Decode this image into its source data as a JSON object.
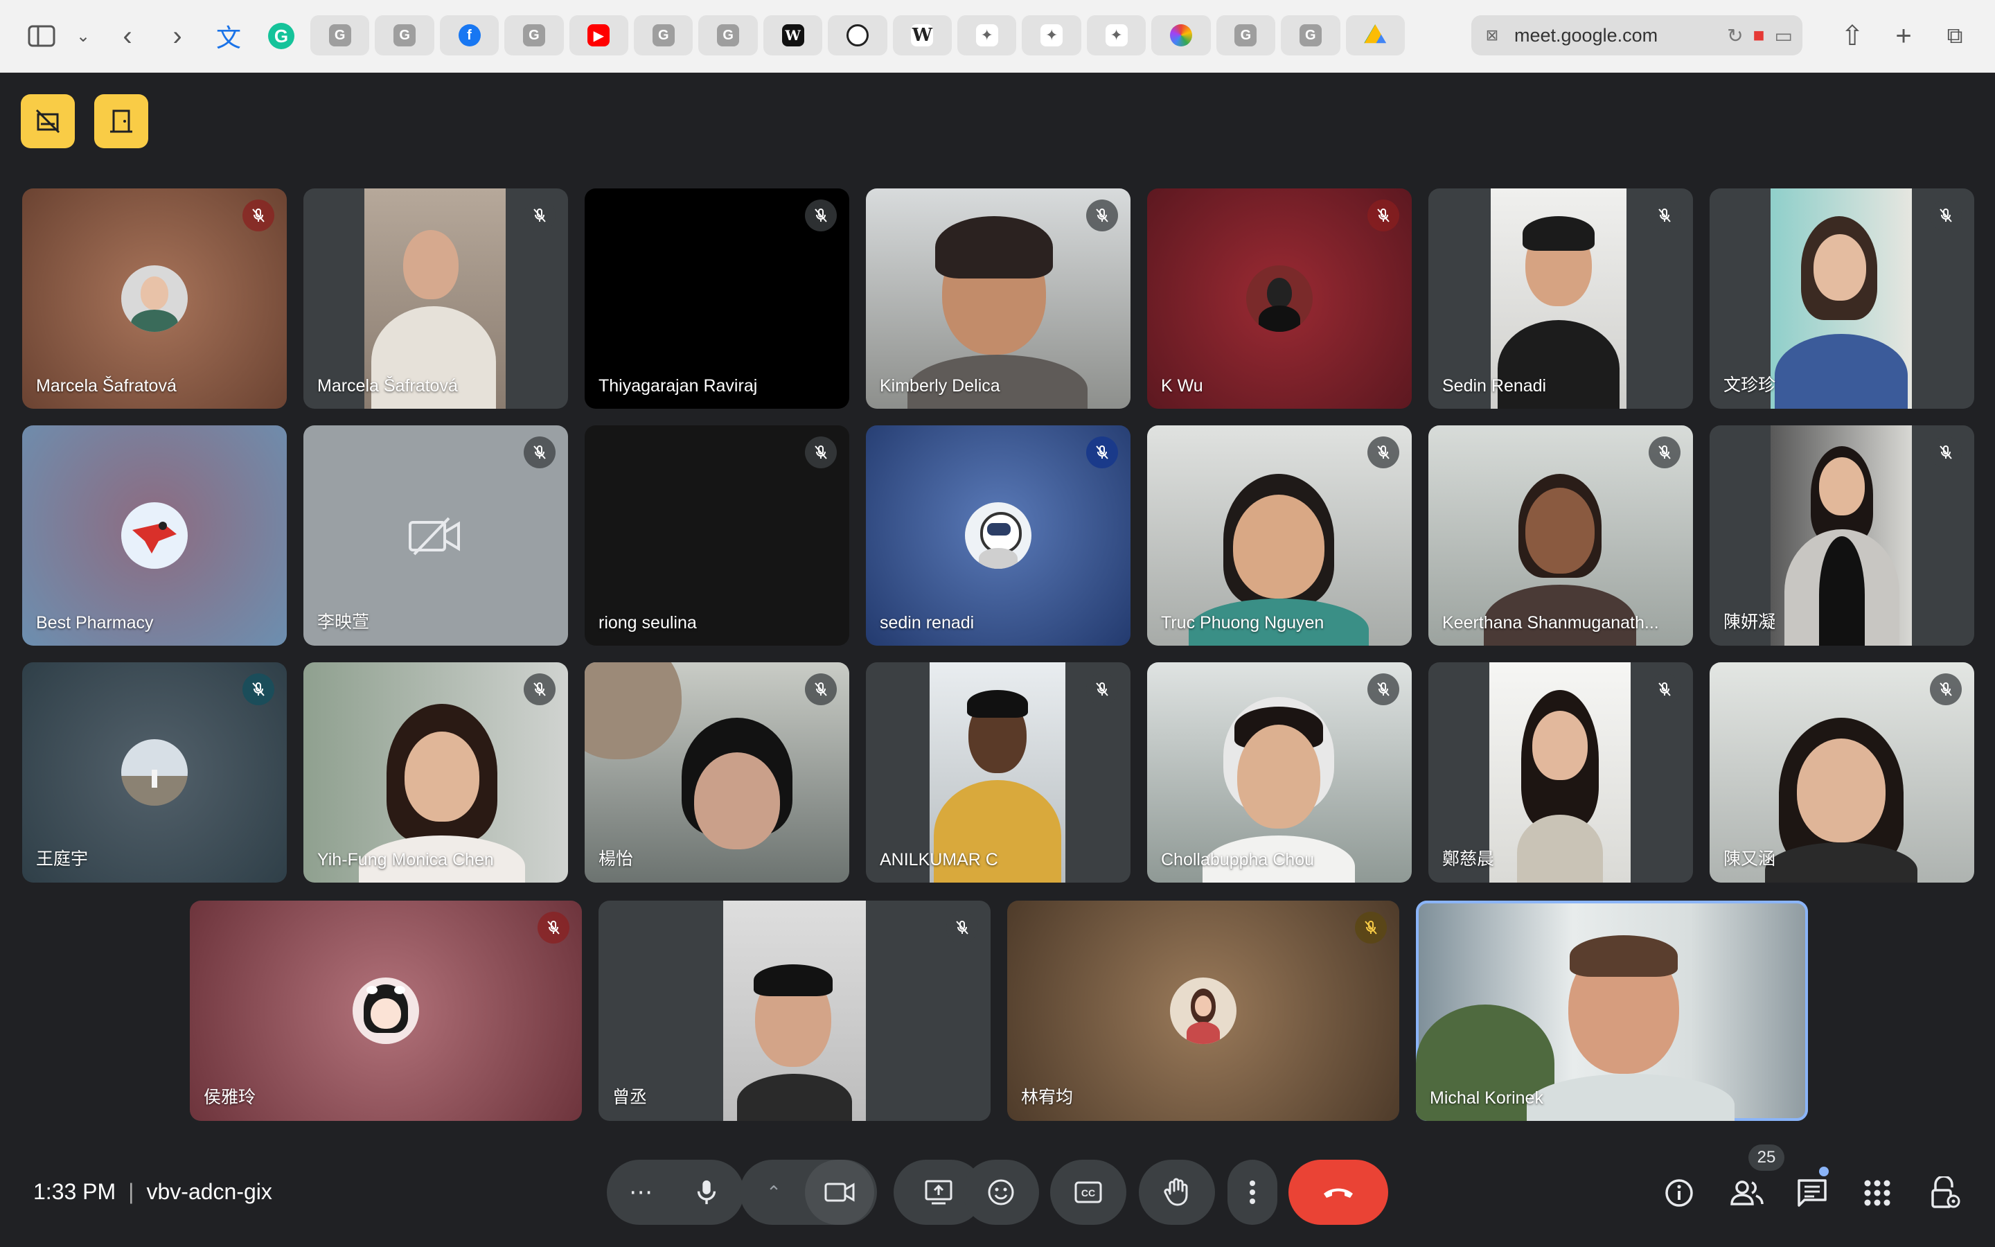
{
  "browser": {
    "url": "meet.google.com",
    "tab_icons": [
      "G",
      "G",
      "f",
      "G",
      "▶",
      "G",
      "G",
      "W",
      "",
      "W",
      "",
      "",
      "",
      "",
      "G",
      "G",
      ""
    ]
  },
  "tiles": [
    {
      "name": "Marcela Šafratová"
    },
    {
      "name": "Marcela Šafratová"
    },
    {
      "name": "Thiyagarajan Raviraj"
    },
    {
      "name": "Kimberly Delica"
    },
    {
      "name": "K Wu"
    },
    {
      "name": "Sedin Renadi"
    },
    {
      "name": "文珍珍"
    },
    {
      "name": "Best Pharmacy"
    },
    {
      "name": "李映萱"
    },
    {
      "name": "riong seulina"
    },
    {
      "name": "sedin renadi"
    },
    {
      "name": "Truc Phuong Nguyen"
    },
    {
      "name": "Keerthana Shanmuganath..."
    },
    {
      "name": "陳妍凝"
    },
    {
      "name": "王庭宇"
    },
    {
      "name": "Yih-Fung Monica Chen"
    },
    {
      "name": "楊怡"
    },
    {
      "name": "ANILKUMAR C"
    },
    {
      "name": "Chollabuppha Chou"
    },
    {
      "name": "鄭慈晨"
    },
    {
      "name": "陳又涵"
    },
    {
      "name": "侯雅玲"
    },
    {
      "name": "曾丞"
    },
    {
      "name": "林宥均"
    },
    {
      "name": "Michal Korinek"
    }
  ],
  "footer": {
    "time": "1:33 PM",
    "separator": "|",
    "meeting_code": "vbv-adcn-gix",
    "participants_count": "25"
  },
  "colors": {
    "background": "#202124",
    "control": "#3c4043",
    "end_call": "#ea4335",
    "highlight": "#8ab4f8",
    "top_buttons": "#f9cc46"
  }
}
